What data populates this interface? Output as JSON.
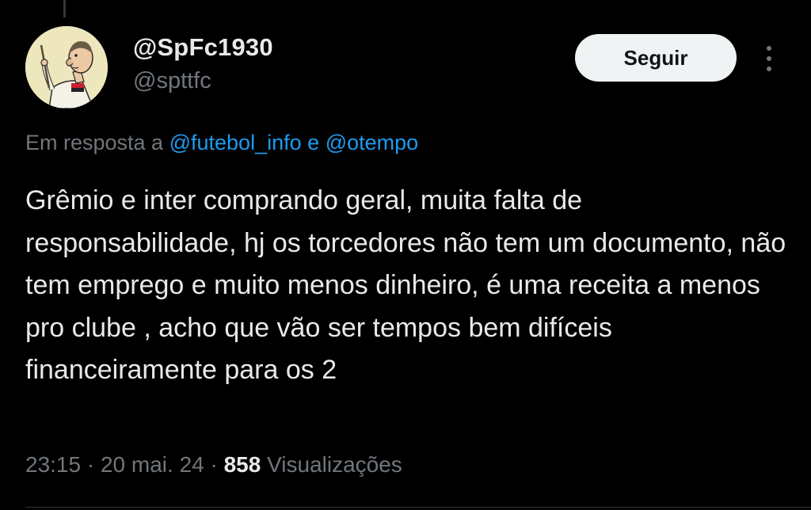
{
  "tweet": {
    "author": {
      "display_name": "@SpFc1930",
      "handle": "@spttfc",
      "avatar_icon": "caricature-avatar"
    },
    "follow_label": "Seguir",
    "more_icon": "more-vertical-icon",
    "reply_to": {
      "prefix": "Em resposta a",
      "mention_1": "@futebol_info",
      "conjunction": "e",
      "mention_2": "@otempo"
    },
    "text": "Grêmio e inter comprando geral, muita falta de responsabilidade, hj os torcedores não tem um documento, não tem emprego e muito menos dinheiro, é uma receita a menos pro clube , acho que vão ser tempos bem difíceis financeiramente para os 2",
    "meta": {
      "time": "23:15",
      "separator": "·",
      "date": "20 mai. 24",
      "views_count": "858",
      "views_label": "Visualizações"
    }
  },
  "colors": {
    "background": "#000000",
    "primary_text": "#e7e9ea",
    "secondary_text": "#71767b",
    "mention": "#1d9bf0",
    "button_bg": "#eff3f4",
    "button_text": "#0f1419"
  }
}
